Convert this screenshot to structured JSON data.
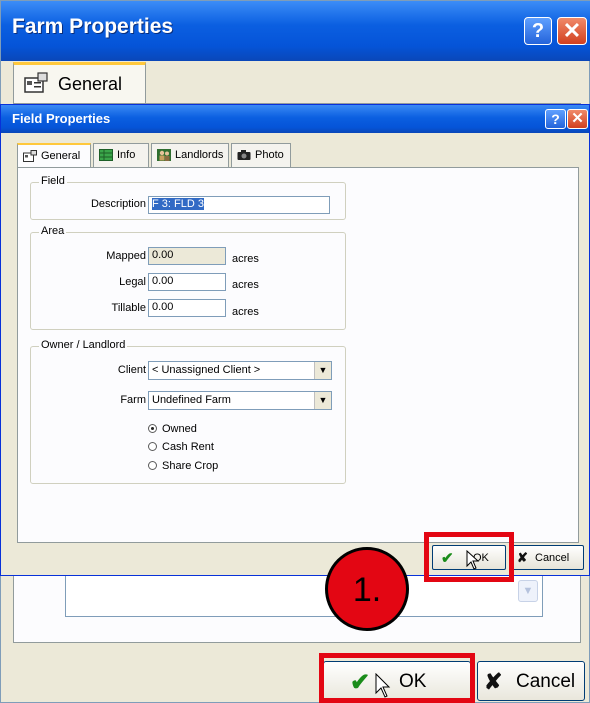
{
  "outer_dialog": {
    "title": "Farm Properties",
    "tab_label": "General",
    "ok_label": "OK",
    "cancel_label": "Cancel"
  },
  "inner_dialog": {
    "title": "Field Properties",
    "tabs": [
      {
        "label": "General",
        "icon": "properties-icon"
      },
      {
        "label": "Info",
        "icon": "grid-icon"
      },
      {
        "label": "Landlords",
        "icon": "people-icon"
      },
      {
        "label": "Photo",
        "icon": "camera-icon"
      }
    ],
    "field_group": {
      "legend": "Field",
      "description_label": "Description",
      "description_value": "F 3: FLD 3"
    },
    "area_group": {
      "legend": "Area",
      "mapped_label": "Mapped",
      "mapped_value": "0.00",
      "legal_label": "Legal",
      "legal_value": "0.00",
      "tillable_label": "Tillable",
      "tillable_value": "0.00",
      "unit": "acres"
    },
    "owner_group": {
      "legend": "Owner / Landlord",
      "client_label": "Client",
      "client_value": "< Unassigned Client >",
      "farm_label": "Farm",
      "farm_value": "Undefined Farm",
      "options": [
        {
          "label": "Owned",
          "selected": true
        },
        {
          "label": "Cash Rent",
          "selected": false
        },
        {
          "label": "Share Crop",
          "selected": false
        }
      ]
    },
    "ok_label": "OK",
    "cancel_label": "Cancel"
  },
  "annotation": {
    "step_label": "1.",
    "highlight_color": "#e30613"
  }
}
